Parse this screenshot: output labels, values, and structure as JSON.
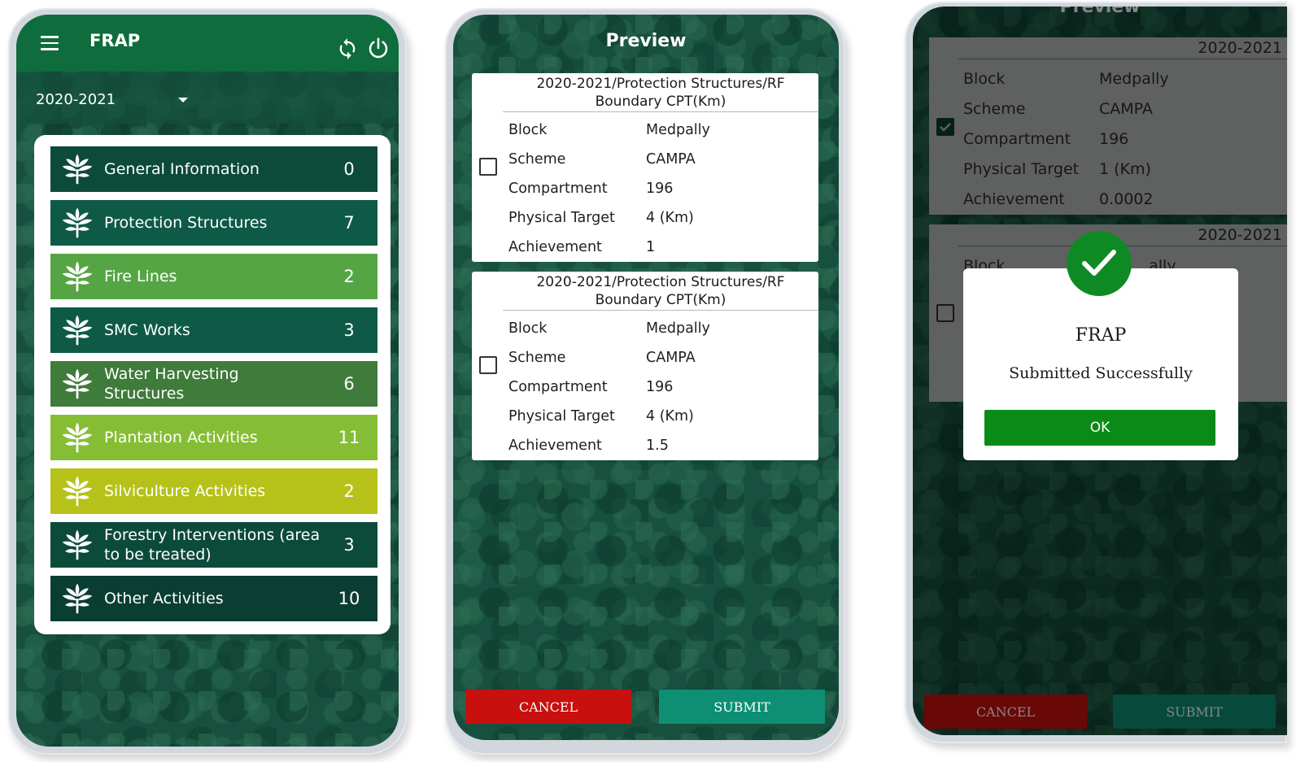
{
  "phone1": {
    "app_title": "FRAP",
    "icons": {
      "menu": "hamburger-menu-icon",
      "sync": "sync-icon",
      "power": "power-icon",
      "caret": "dropdown-caret-icon",
      "tree": "tree-icon"
    },
    "year_select": {
      "value": "2020-2021"
    },
    "menu_items": [
      {
        "label": "General Information",
        "count": "0",
        "color": "#0c4a3a"
      },
      {
        "label": "Protection Structures",
        "count": "7",
        "color": "#0e5a47"
      },
      {
        "label": "Fire Lines",
        "count": "2",
        "color": "#55a545"
      },
      {
        "label": "SMC Works",
        "count": "3",
        "color": "#0e5a47"
      },
      {
        "label": "Water Harvesting Structures",
        "count": "6",
        "color": "#3f7b3a"
      },
      {
        "label": "Plantation Activities",
        "count": "11",
        "color": "#85be34"
      },
      {
        "label": "Silviculture Activities",
        "count": "2",
        "color": "#b6c219"
      },
      {
        "label": "Forestry Interventions (area to be treated)",
        "count": "3",
        "color": "#0c4a3a"
      },
      {
        "label": "Other Activities",
        "count": "10",
        "color": "#0b3e33"
      }
    ]
  },
  "phone2": {
    "title": "Preview",
    "field_labels": {
      "block": "Block",
      "scheme": "Scheme",
      "compartment": "Compartment",
      "physical_target": "Physical Target",
      "achievement": "Achievement"
    },
    "cards": [
      {
        "heading_line1": "2020-2021/Protection Structures/RF",
        "heading_line2": "Boundary CPT(Km)",
        "checked": false,
        "block": "Medpally",
        "scheme": "CAMPA",
        "compartment": "196",
        "physical_target": "4 (Km)",
        "achievement": "1"
      },
      {
        "heading_line1": "2020-2021/Protection Structures/RF",
        "heading_line2": "Boundary CPT(Km)",
        "checked": false,
        "block": "Medpally",
        "scheme": "CAMPA",
        "compartment": "196",
        "physical_target": "4 (Km)",
        "achievement": "1.5"
      }
    ],
    "cancel_label": "CANCEL",
    "submit_label": "SUBMIT",
    "colors": {
      "cancel": "#c8100f",
      "submit": "#0e8f74"
    }
  },
  "phone3": {
    "title": "Preview",
    "cards": [
      {
        "year": "2020-2021",
        "checked": true,
        "block": "Medpally",
        "scheme": "CAMPA",
        "compartment": "196",
        "physical_target": "1 (Km)",
        "achievement": "0.0002"
      },
      {
        "year": "2020-2021",
        "checked": false,
        "block_label": "Block",
        "block_partial": "...ally"
      }
    ],
    "dialog": {
      "title": "FRAP",
      "message": "Submitted Successfully",
      "ok_label": "OK",
      "icon": "checkmark-icon"
    },
    "cancel_label": "CANCEL",
    "submit_label": "SUBMIT"
  }
}
